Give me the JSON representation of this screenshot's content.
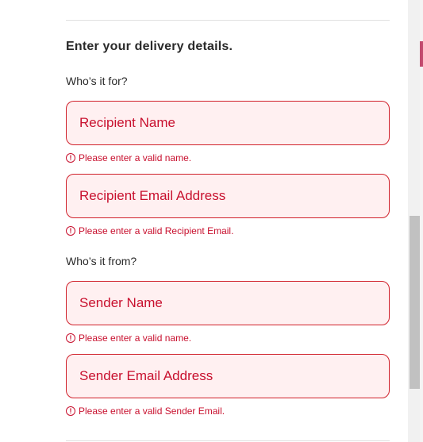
{
  "form": {
    "title": "Enter your delivery details.",
    "recipient_group_label": "Who’s it for?",
    "sender_group_label": "Who’s it from?",
    "fields": [
      {
        "placeholder": "Recipient Name",
        "value": "",
        "error": "Please enter a valid name."
      },
      {
        "placeholder": "Recipient Email Address",
        "value": "",
        "error": "Please enter a valid Recipient Email."
      },
      {
        "placeholder": "Sender Name",
        "value": "",
        "error": "Please enter a valid name."
      },
      {
        "placeholder": "Sender Email Address",
        "value": "",
        "error": "Please enter a valid Sender Email."
      }
    ],
    "error_icon_glyph": "!"
  },
  "icons": {
    "error": "alert-circle-icon"
  },
  "colors": {
    "error": "#c8102e",
    "field_background": "#fff0f1",
    "field_border": "#d0202a",
    "text": "#2a2a2a"
  }
}
